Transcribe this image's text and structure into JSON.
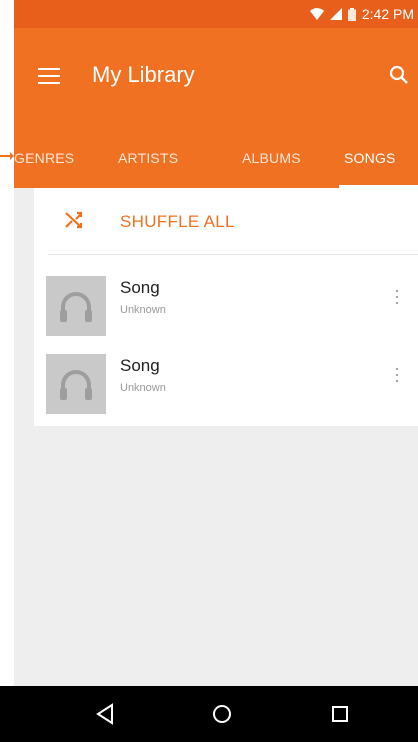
{
  "status_bar": {
    "time": "2:42 PM"
  },
  "app_bar": {
    "title": "My Library"
  },
  "tabs": [
    {
      "label": "GENRES"
    },
    {
      "label": "ARTISTS"
    },
    {
      "label": "ALBUMS"
    },
    {
      "label": "SONGS",
      "active": true
    }
  ],
  "shuffle": {
    "label": "SHUFFLE ALL"
  },
  "songs": [
    {
      "title": "Song",
      "artist": "Unknown"
    },
    {
      "title": "Song",
      "artist": "Unknown"
    }
  ],
  "colors": {
    "status_bar": "#e85f1c",
    "app_bar": "#f07122",
    "accent": "#f07122"
  },
  "icons": [
    "menu-icon",
    "search-icon",
    "shuffle-icon",
    "headphones-icon",
    "more-vertical-icon",
    "back-icon",
    "home-icon",
    "recents-icon",
    "wifi-icon",
    "signal-icon",
    "battery-icon"
  ]
}
